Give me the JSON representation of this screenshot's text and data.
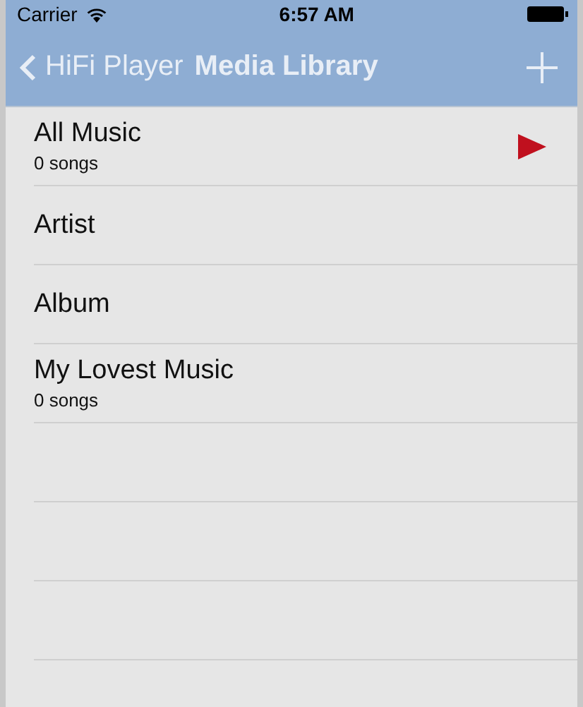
{
  "status_bar": {
    "carrier": "Carrier",
    "time": "6:57 AM"
  },
  "nav_bar": {
    "back": "HiFi Player",
    "title": "Media Library"
  },
  "rows": [
    {
      "title": "All Music",
      "subtitle": "0 songs",
      "playing": true
    },
    {
      "title": "Artist",
      "playing": false
    },
    {
      "title": "Album",
      "playing": false
    },
    {
      "title": "My Lovest Music",
      "subtitle": "0 songs",
      "playing": false
    }
  ]
}
